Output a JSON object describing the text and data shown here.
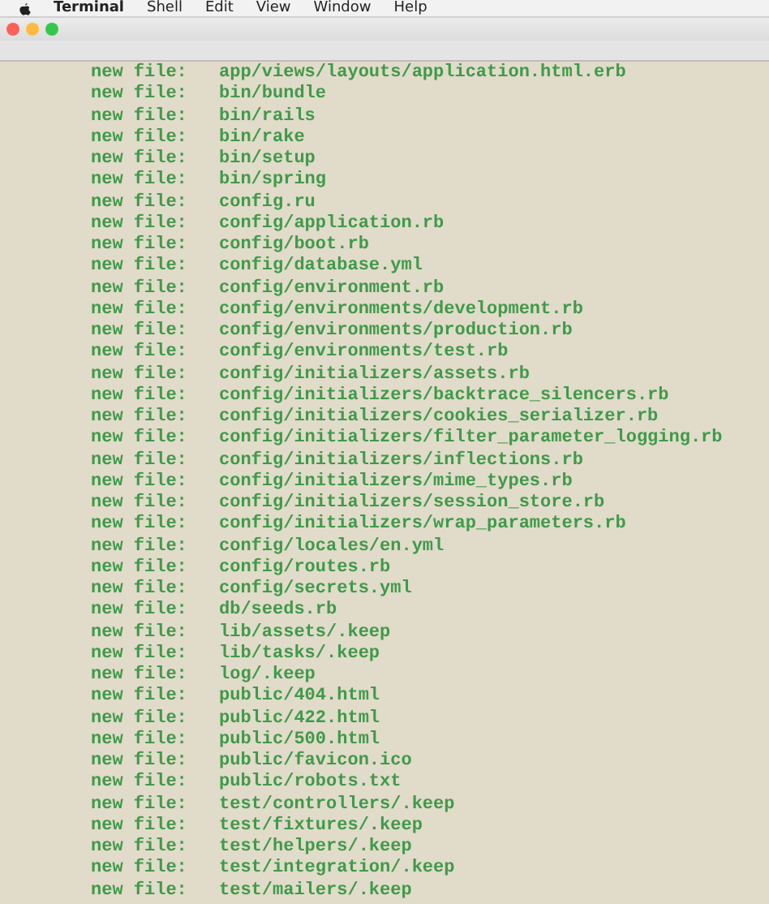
{
  "menu_bar": {
    "items": [
      {
        "label": "Terminal",
        "kind": "app"
      },
      {
        "label": "Shell",
        "kind": "menu"
      },
      {
        "label": "Edit",
        "kind": "menu"
      },
      {
        "label": "View",
        "kind": "menu"
      },
      {
        "label": "Window",
        "kind": "menu"
      },
      {
        "label": "Help",
        "kind": "menu"
      }
    ]
  },
  "terminal": {
    "lines": [
      {
        "status": "new file:",
        "path": "app/views/layouts/application.html.erb"
      },
      {
        "status": "new file:",
        "path": "bin/bundle"
      },
      {
        "status": "new file:",
        "path": "bin/rails"
      },
      {
        "status": "new file:",
        "path": "bin/rake"
      },
      {
        "status": "new file:",
        "path": "bin/setup"
      },
      {
        "status": "new file:",
        "path": "bin/spring"
      },
      {
        "status": "new file:",
        "path": "config.ru"
      },
      {
        "status": "new file:",
        "path": "config/application.rb"
      },
      {
        "status": "new file:",
        "path": "config/boot.rb"
      },
      {
        "status": "new file:",
        "path": "config/database.yml"
      },
      {
        "status": "new file:",
        "path": "config/environment.rb"
      },
      {
        "status": "new file:",
        "path": "config/environments/development.rb"
      },
      {
        "status": "new file:",
        "path": "config/environments/production.rb"
      },
      {
        "status": "new file:",
        "path": "config/environments/test.rb"
      },
      {
        "status": "new file:",
        "path": "config/initializers/assets.rb"
      },
      {
        "status": "new file:",
        "path": "config/initializers/backtrace_silencers.rb"
      },
      {
        "status": "new file:",
        "path": "config/initializers/cookies_serializer.rb"
      },
      {
        "status": "new file:",
        "path": "config/initializers/filter_parameter_logging.rb"
      },
      {
        "status": "new file:",
        "path": "config/initializers/inflections.rb"
      },
      {
        "status": "new file:",
        "path": "config/initializers/mime_types.rb"
      },
      {
        "status": "new file:",
        "path": "config/initializers/session_store.rb"
      },
      {
        "status": "new file:",
        "path": "config/initializers/wrap_parameters.rb"
      },
      {
        "status": "new file:",
        "path": "config/locales/en.yml"
      },
      {
        "status": "new file:",
        "path": "config/routes.rb"
      },
      {
        "status": "new file:",
        "path": "config/secrets.yml"
      },
      {
        "status": "new file:",
        "path": "db/seeds.rb"
      },
      {
        "status": "new file:",
        "path": "lib/assets/.keep"
      },
      {
        "status": "new file:",
        "path": "lib/tasks/.keep"
      },
      {
        "status": "new file:",
        "path": "log/.keep"
      },
      {
        "status": "new file:",
        "path": "public/404.html"
      },
      {
        "status": "new file:",
        "path": "public/422.html"
      },
      {
        "status": "new file:",
        "path": "public/500.html"
      },
      {
        "status": "new file:",
        "path": "public/favicon.ico"
      },
      {
        "status": "new file:",
        "path": "public/robots.txt"
      },
      {
        "status": "new file:",
        "path": "test/controllers/.keep"
      },
      {
        "status": "new file:",
        "path": "test/fixtures/.keep"
      },
      {
        "status": "new file:",
        "path": "test/helpers/.keep"
      },
      {
        "status": "new file:",
        "path": "test/integration/.keep"
      },
      {
        "status": "new file:",
        "path": "test/mailers/.keep"
      }
    ]
  }
}
